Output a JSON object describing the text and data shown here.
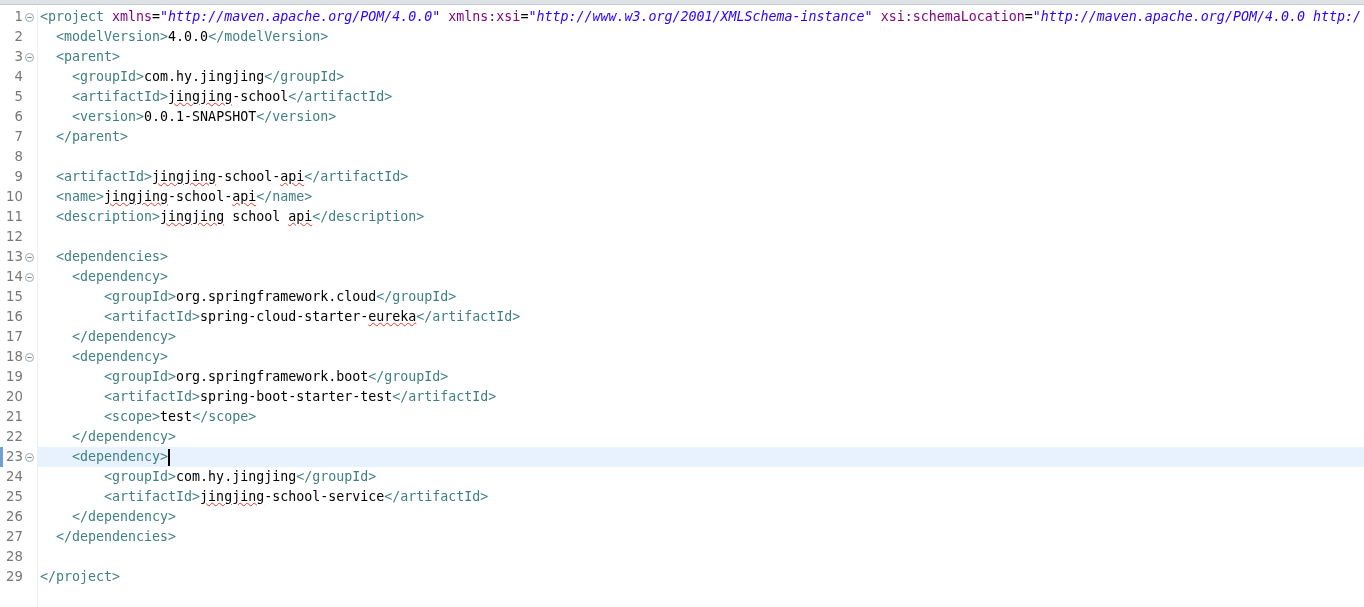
{
  "editor": {
    "lines": [
      {
        "number": "1",
        "foldable": true,
        "current": false,
        "tokens": [
          {
            "kind": "tag",
            "text": "<project"
          },
          {
            "kind": "attr",
            "text": " xmlns"
          },
          {
            "kind": "eq",
            "text": "="
          },
          {
            "kind": "string",
            "text": "\"http://maven.apache.org/POM/4.0.0\""
          },
          {
            "kind": "attr",
            "text": " xmlns:xsi"
          },
          {
            "kind": "eq",
            "text": "="
          },
          {
            "kind": "string",
            "text": "\"http://www.w3.org/2001/XMLSchema-instance\""
          },
          {
            "kind": "attr",
            "text": " xsi:schemaLocation"
          },
          {
            "kind": "eq",
            "text": "="
          },
          {
            "kind": "string",
            "text": "\"http://maven.apache.org/POM/4.0.0 http:/"
          }
        ]
      },
      {
        "number": "2",
        "foldable": false,
        "current": false,
        "tokens": [
          {
            "kind": "tag",
            "text": "  <modelVersion>"
          },
          {
            "kind": "text",
            "text": "4.0.0",
            "squiggle": false
          },
          {
            "kind": "tag",
            "text": "</modelVersion>"
          }
        ]
      },
      {
        "number": "3",
        "foldable": true,
        "current": false,
        "tokens": [
          {
            "kind": "tag",
            "text": "  <parent>"
          }
        ]
      },
      {
        "number": "4",
        "foldable": false,
        "current": false,
        "tokens": [
          {
            "kind": "tag",
            "text": "    <groupId>"
          },
          {
            "kind": "text",
            "text": "com.hy.jingjing",
            "squiggle": false
          },
          {
            "kind": "tag",
            "text": "</groupId>"
          }
        ]
      },
      {
        "number": "5",
        "foldable": false,
        "current": false,
        "tokens": [
          {
            "kind": "tag",
            "text": "    <artifactId>"
          },
          {
            "kind": "text",
            "text": "jingjing",
            "squiggle": true
          },
          {
            "kind": "text",
            "text": "-school",
            "squiggle": false
          },
          {
            "kind": "tag",
            "text": "</artifactId>"
          }
        ]
      },
      {
        "number": "6",
        "foldable": false,
        "current": false,
        "tokens": [
          {
            "kind": "tag",
            "text": "    <version>"
          },
          {
            "kind": "text",
            "text": "0.0.1-SNAPSHOT",
            "squiggle": false
          },
          {
            "kind": "tag",
            "text": "</version>"
          }
        ]
      },
      {
        "number": "7",
        "foldable": false,
        "current": false,
        "tokens": [
          {
            "kind": "tag",
            "text": "  </parent>"
          }
        ]
      },
      {
        "number": "8",
        "foldable": false,
        "current": false
      },
      {
        "number": "9",
        "foldable": false,
        "current": false,
        "tokens": [
          {
            "kind": "tag",
            "text": "  <artifactId>"
          },
          {
            "kind": "text",
            "text": "jingjing",
            "squiggle": true
          },
          {
            "kind": "text",
            "text": "-school-",
            "squiggle": false
          },
          {
            "kind": "text",
            "text": "api",
            "squiggle": true
          },
          {
            "kind": "tag",
            "text": "</artifactId>"
          }
        ]
      },
      {
        "number": "10",
        "foldable": false,
        "current": false,
        "tokens": [
          {
            "kind": "tag",
            "text": "  <name>"
          },
          {
            "kind": "text",
            "text": "jingjing",
            "squiggle": true
          },
          {
            "kind": "text",
            "text": "-school-",
            "squiggle": false
          },
          {
            "kind": "text",
            "text": "api",
            "squiggle": true
          },
          {
            "kind": "tag",
            "text": "</name>"
          }
        ]
      },
      {
        "number": "11",
        "foldable": false,
        "current": false,
        "tokens": [
          {
            "kind": "tag",
            "text": "  <description>"
          },
          {
            "kind": "text",
            "text": "jingjing",
            "squiggle": true
          },
          {
            "kind": "text",
            "text": " school ",
            "squiggle": false
          },
          {
            "kind": "text",
            "text": "api",
            "squiggle": true
          },
          {
            "kind": "tag",
            "text": "</description>"
          }
        ]
      },
      {
        "number": "12",
        "foldable": false,
        "current": false
      },
      {
        "number": "13",
        "foldable": true,
        "current": false,
        "tokens": [
          {
            "kind": "tag",
            "text": "  <dependencies>"
          }
        ]
      },
      {
        "number": "14",
        "foldable": true,
        "current": false,
        "tokens": [
          {
            "kind": "tag",
            "text": "    <dependency>"
          }
        ]
      },
      {
        "number": "15",
        "foldable": false,
        "current": false,
        "tokens": [
          {
            "kind": "tag",
            "text": "        <groupId>"
          },
          {
            "kind": "text",
            "text": "org.springframework.cloud",
            "squiggle": false
          },
          {
            "kind": "tag",
            "text": "</groupId>"
          }
        ]
      },
      {
        "number": "16",
        "foldable": false,
        "current": false,
        "tokens": [
          {
            "kind": "tag",
            "text": "        <artifactId>"
          },
          {
            "kind": "text",
            "text": "spring-cloud-starter-",
            "squiggle": false
          },
          {
            "kind": "text",
            "text": "eureka",
            "squiggle": true
          },
          {
            "kind": "tag",
            "text": "</artifactId>"
          }
        ]
      },
      {
        "number": "17",
        "foldable": false,
        "current": false,
        "tokens": [
          {
            "kind": "tag",
            "text": "    </dependency>"
          }
        ]
      },
      {
        "number": "18",
        "foldable": true,
        "current": false,
        "tokens": [
          {
            "kind": "tag",
            "text": "    <dependency>"
          }
        ]
      },
      {
        "number": "19",
        "foldable": false,
        "current": false,
        "tokens": [
          {
            "kind": "tag",
            "text": "        <groupId>"
          },
          {
            "kind": "text",
            "text": "org.springframework.boot",
            "squiggle": false
          },
          {
            "kind": "tag",
            "text": "</groupId>"
          }
        ]
      },
      {
        "number": "20",
        "foldable": false,
        "current": false,
        "tokens": [
          {
            "kind": "tag",
            "text": "        <artifactId>"
          },
          {
            "kind": "text",
            "text": "spring-boot-starter-test",
            "squiggle": false
          },
          {
            "kind": "tag",
            "text": "</artifactId>"
          }
        ]
      },
      {
        "number": "21",
        "foldable": false,
        "current": false,
        "tokens": [
          {
            "kind": "tag",
            "text": "        <scope>"
          },
          {
            "kind": "text",
            "text": "test",
            "squiggle": false
          },
          {
            "kind": "tag",
            "text": "</scope>"
          }
        ]
      },
      {
        "number": "22",
        "foldable": false,
        "current": false,
        "tokens": [
          {
            "kind": "tag",
            "text": "    </dependency>"
          }
        ]
      },
      {
        "number": "23",
        "foldable": true,
        "current": true,
        "tokens": [
          {
            "kind": "tag",
            "text": "    <dependency>"
          }
        ]
      },
      {
        "number": "24",
        "foldable": false,
        "current": false,
        "tokens": [
          {
            "kind": "tag",
            "text": "        <groupId>"
          },
          {
            "kind": "text",
            "text": "com.hy.jingjing",
            "squiggle": false
          },
          {
            "kind": "tag",
            "text": "</groupId>"
          }
        ]
      },
      {
        "number": "25",
        "foldable": false,
        "current": false,
        "tokens": [
          {
            "kind": "tag",
            "text": "        <artifactId>"
          },
          {
            "kind": "text",
            "text": "jingjing",
            "squiggle": true
          },
          {
            "kind": "text",
            "text": "-school-service",
            "squiggle": false
          },
          {
            "kind": "tag",
            "text": "</artifactId>"
          }
        ]
      },
      {
        "number": "26",
        "foldable": false,
        "current": false,
        "tokens": [
          {
            "kind": "tag",
            "text": "    </dependency>"
          }
        ]
      },
      {
        "number": "27",
        "foldable": false,
        "current": false,
        "tokens": [
          {
            "kind": "tag",
            "text": "  </dependencies>"
          }
        ]
      },
      {
        "number": "28",
        "foldable": false,
        "current": false
      },
      {
        "number": "29",
        "foldable": false,
        "current": false,
        "tokens": [
          {
            "kind": "tag",
            "text": "</project>"
          }
        ]
      }
    ]
  }
}
